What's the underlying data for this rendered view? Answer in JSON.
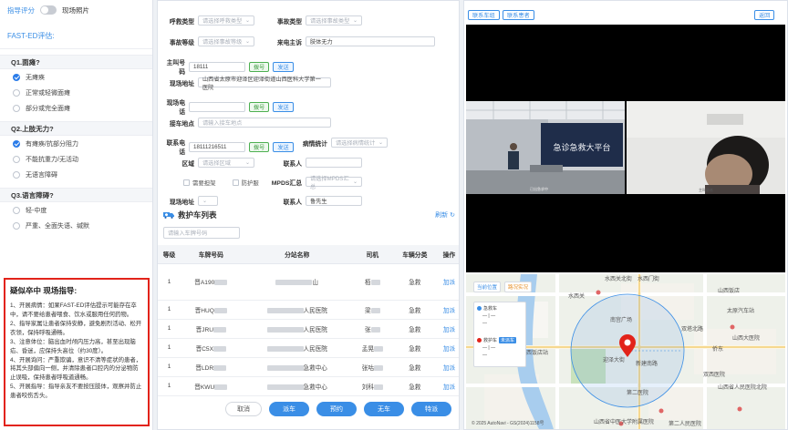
{
  "left": {
    "mode_link": "指导评分",
    "toggle_label": "现场照片",
    "title": "FAST-ED评估:",
    "questions": [
      {
        "title": "Q1.面瘫?",
        "options": [
          {
            "label": "无瘫痪",
            "selected": true
          },
          {
            "label": "正常或轻微面瘫",
            "selected": false
          },
          {
            "label": "部分或完全面瘫",
            "selected": false
          }
        ]
      },
      {
        "title": "Q2.上肢无力?",
        "options": [
          {
            "label": "有瘫痪/抗部分阻力",
            "selected": true
          },
          {
            "label": "不能抗重力/无活动",
            "selected": false
          },
          {
            "label": "无语言障碍",
            "selected": false
          }
        ]
      },
      {
        "title": "Q3.语言障碍?",
        "options": [
          {
            "label": "轻-中度",
            "selected": false
          },
          {
            "label": "严重、全面失语、缄默",
            "selected": false
          }
        ]
      }
    ],
    "guide": {
      "title": "疑似卒中 现场指导:",
      "text": "1、开展病情：如果FAST-ED评估提示可能存在卒中，请不要给患者喂食、饮水或服用任何药物。\n2、指导家属让患者保持安静，避免剧烈活动、松开衣领，保持呼吸通畅。\n3、注意体位：脑出血时颅内压力高，甚至出现脑疝、昏迷，应保持头高位（约30度）。\n4、开展询问：严重欺骗，意识不清等症状的患者，将其头部偏向一侧，并清除患者口腔内的分泌物防止误吸，保持患者呼吸道通畅。\n5、开展指导：指导亲友不要按压肢体，观察并防止患者咬伤舌头。"
    }
  },
  "form": {
    "call_type_label": "呼救类型",
    "call_type_ph": "请选择呼救类型",
    "event_type_label": "事故类型",
    "event_type_ph": "请选择事故类型",
    "event_level_label": "事故等级",
    "event_level_ph": "请选择事故等级",
    "complaint_label": "来电主诉",
    "complaint_value": "肢体无力",
    "caller_label": "主叫号码",
    "caller_value": "18111",
    "dial_btn": "拨号",
    "send_btn": "发送",
    "address_label": "现场地址",
    "address_value": "山西省太原市迎泽区迎泽街道山西医科大学第一医院",
    "site_phone_label": "现场电话",
    "pickup_label": "接车地点",
    "pickup_ph": "请输入接车地点",
    "contact_phone_label": "联系电话",
    "contact_phone_value": "18111216511",
    "stats_label": "病情统计",
    "stats_ph": "请选择病情统计",
    "region_label": "区域",
    "region_ph": "请选择区域",
    "contact_person_label": "联系人",
    "chk1": "需要担架",
    "chk2": "防护服",
    "mpds_label": "MPDS汇总",
    "mpds_ph": "请选择MPDS汇总",
    "extra_label": "现场地址",
    "extra_value": "鲁先生"
  },
  "ambulance": {
    "title": "救护车列表",
    "refresh": "刷新",
    "search_ph": "请输入车牌号码",
    "headers": [
      "等级",
      "车牌号码",
      "分站名称",
      "司机",
      "车辆分类",
      "操作"
    ],
    "rows": [
      {
        "level": "1",
        "plate": "晋A190",
        "station": "山",
        "driver": "栢",
        "category": "急救",
        "action": "加派"
      },
      {
        "level": "1",
        "plate": "晋HUQ",
        "station": "人民医院",
        "driver": "梁",
        "category": "急救",
        "action": "加派"
      },
      {
        "level": "1",
        "plate": "晋JRU",
        "station": "人民医院",
        "driver": "张",
        "category": "急救",
        "action": "加派"
      },
      {
        "level": "1",
        "plate": "晋C5X",
        "station": "人民医院",
        "driver": "孟晃",
        "category": "急救",
        "action": "加派"
      },
      {
        "level": "1",
        "plate": "晋LDR",
        "station": "急救中心",
        "driver": "张咕",
        "category": "急救",
        "action": "加派"
      },
      {
        "level": "1",
        "plate": "晋KWU",
        "station": "急救中心",
        "driver": "刘科",
        "category": "急救",
        "action": "加派"
      }
    ],
    "buttons": {
      "cancel": "取消",
      "new_car": "派车",
      "reserve": "预约",
      "no_car": "无车",
      "special": "特派"
    }
  },
  "right": {
    "btn_car": "联系车组",
    "btn_patient": "联系患者",
    "btn_back": "返回",
    "video_wall_text": "急诊急救大平台",
    "video_caption1": "已出急求中",
    "video_caption2": "主叫患者",
    "map": {
      "labels": [
        "水西关北街",
        "水西门街",
        "山西饭店",
        "水西关",
        "太原汽车站",
        "南宫广场",
        "山西大医院",
        "双塔北路",
        "侨东",
        "迎泽大街",
        "新建南路",
        "山西省人民医院北院",
        "双西医院",
        "第二人民医院",
        "山西省中医大学附属医院",
        "山西饭店站",
        "第二医院"
      ],
      "ctrl1": "当前位置",
      "ctrl2": "路况实况",
      "legend_item1": "急救车",
      "legend_item2": "救护车",
      "legend_tag": "未派车",
      "copyright": "© 2025 AutoNavi - GS(2024)1158号"
    }
  },
  "colors": {
    "primary": "#3a8ee6",
    "danger": "#e2231a",
    "pin": "#e2231a"
  }
}
